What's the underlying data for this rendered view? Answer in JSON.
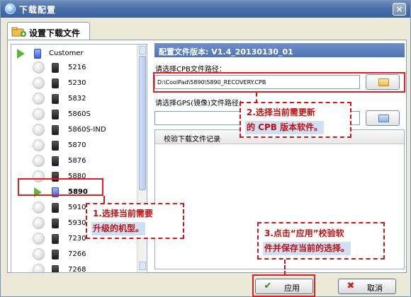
{
  "window": {
    "title": "下载配置",
    "close_label": "×"
  },
  "tab": {
    "label": "设置下载文件",
    "icon": "folder-plus-icon"
  },
  "tree": {
    "root": "Customer",
    "items": [
      "5216",
      "5230",
      "5832",
      "5860S",
      "5860S-IND",
      "5870",
      "5876",
      "5880",
      "5890",
      "5910",
      "5930",
      "7230",
      "7266",
      "7268"
    ],
    "selected": "5890"
  },
  "config": {
    "version_label": "配置文件版本: V1.4_20130130_01",
    "cpb_label": "请选择CPB文件路径：",
    "cpb_path": "D:\\CoolPad\\5890\\5890_RECOVERY.CPB",
    "gps_label": "请选择GPS(镜像)文件路径：",
    "gps_path": "",
    "log_header": "校验下载文件记录"
  },
  "annotations": {
    "step1_line1": "1.选择当前需要",
    "step1_line2": "升级的机型。",
    "step2_line1": "2.选择当前需更新",
    "step2_line2": "的 CPB 版本软件。",
    "step3_line1": "3.点击“应用”校验软",
    "step3_line2": "件并保存当前的选择。",
    "color": "#d01818"
  },
  "buttons": {
    "apply": "应用",
    "cancel": "取消"
  }
}
